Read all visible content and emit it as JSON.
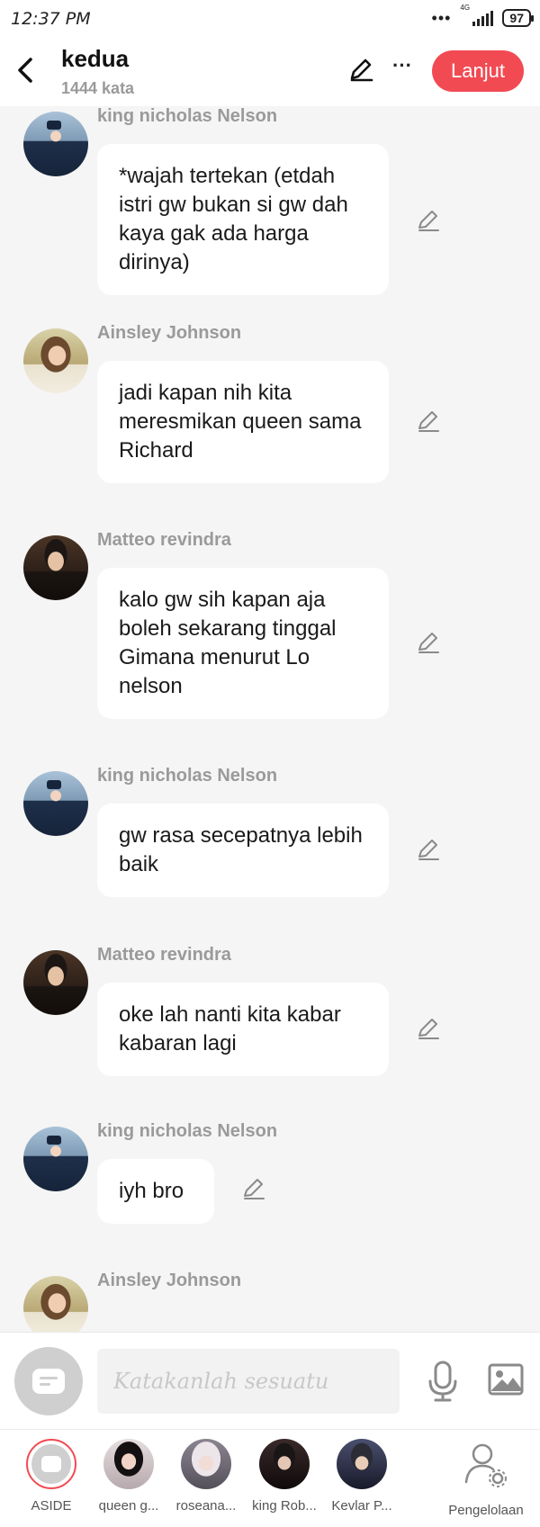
{
  "status_bar": {
    "time": "12:37 PM",
    "dots": "•••",
    "network": "4G",
    "battery": "97"
  },
  "header": {
    "title": "kedua",
    "subtitle": "1444 kata",
    "next_label": "Lanjut",
    "more_label": "···"
  },
  "messages": [
    {
      "sender": "king nicholas Nelson",
      "avatar": "king",
      "text": "*wajah tertekan (etdah istri gw bukan si gw dah kaya gak ada harga dirinya)"
    },
    {
      "sender": "Ainsley Johnson",
      "avatar": "ainsley",
      "text": "jadi kapan nih kita meresmikan queen sama Richard"
    },
    {
      "sender": "Matteo revindra",
      "avatar": "matteo",
      "text": "kalo gw sih kapan aja boleh sekarang tinggal Gimana menurut Lo nelson"
    },
    {
      "sender": "king nicholas Nelson",
      "avatar": "king",
      "text": "gw rasa secepatnya lebih baik"
    },
    {
      "sender": "Matteo revindra",
      "avatar": "matteo",
      "text": "oke lah nanti kita kabar kabaran lagi"
    },
    {
      "sender": "king nicholas Nelson",
      "avatar": "king",
      "text": "iyh bro"
    },
    {
      "sender": "Ainsley Johnson",
      "avatar": "ainsley",
      "text": ""
    }
  ],
  "input": {
    "placeholder": "Katakanlah sesuatu"
  },
  "characters": [
    {
      "label": "ASIDE"
    },
    {
      "label": "queen g..."
    },
    {
      "label": "roseana..."
    },
    {
      "label": "king Rob..."
    },
    {
      "label": "Kevlar P..."
    },
    {
      "label": "Pengelolaan"
    }
  ]
}
